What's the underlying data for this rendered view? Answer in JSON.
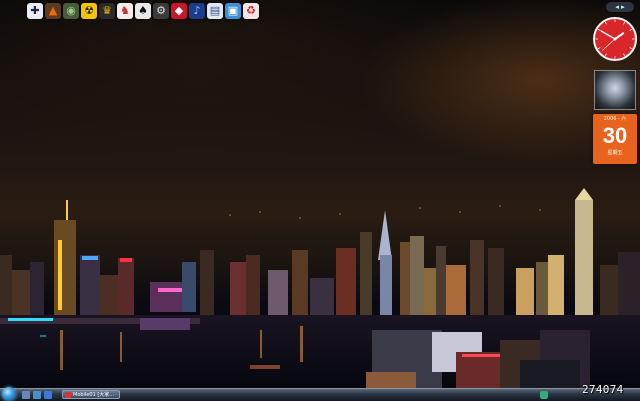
{
  "quick_icons": [
    {
      "name": "security-shield-icon",
      "glyph": "✚",
      "bg": "#e8eef5",
      "fg": "#224"
    },
    {
      "name": "triangle-app-icon",
      "glyph": "▲",
      "bg": "#5b3a22",
      "fg": "#f60"
    },
    {
      "name": "globe-icon",
      "glyph": "◉",
      "bg": "#4a5a3a",
      "fg": "#9c8"
    },
    {
      "name": "radiation-icon",
      "glyph": "☢",
      "bg": "#f5c400",
      "fg": "#222"
    },
    {
      "name": "trophy-icon",
      "glyph": "♛",
      "bg": "#2a2a2a",
      "fg": "#e9b400"
    },
    {
      "name": "rabbit-icon",
      "glyph": "♞",
      "bg": "#f3eded",
      "fg": "#b33"
    },
    {
      "name": "cards-icon",
      "glyph": "♠",
      "bg": "#e8e8e8",
      "fg": "#111"
    },
    {
      "name": "gears-icon",
      "glyph": "⚙",
      "bg": "#3a3a3a",
      "fg": "#ddd"
    },
    {
      "name": "car-icon",
      "glyph": "◆",
      "bg": "#c9162b",
      "fg": "#fff"
    },
    {
      "name": "music-note-icon",
      "glyph": "♪",
      "bg": "#1e3b8a",
      "fg": "#8cf"
    },
    {
      "name": "notepad-icon",
      "glyph": "▤",
      "bg": "#dfe8f2",
      "fg": "#358"
    },
    {
      "name": "package-icon",
      "glyph": "▣",
      "bg": "#3f8fd6",
      "fg": "#fff"
    },
    {
      "name": "recycle-bin-icon",
      "glyph": "♻",
      "bg": "#f0e6e6",
      "fg": "#c22"
    }
  ],
  "colors": {
    "clock_face": "#d9262b",
    "calendar_bg": "#e8641e",
    "taskbar": "#2d3846"
  },
  "calendar": {
    "month": "2006 · 六",
    "day": "30",
    "weekday": "星期五"
  },
  "clock": {
    "hour": 1,
    "minute": 50,
    "second": 38
  },
  "sidebar": {
    "control": "◂ ▸"
  },
  "taskbar": {
    "window_title": "Mobile01 [大家...",
    "start_label": "start-orb"
  },
  "watermark": "274074"
}
